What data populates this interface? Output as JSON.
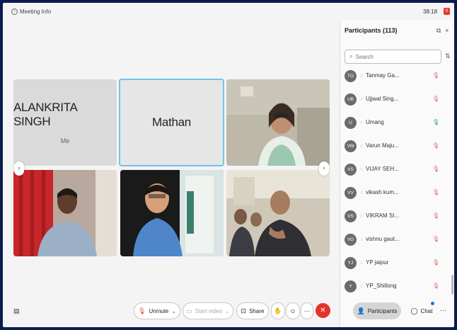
{
  "header": {
    "title": "Meeting Info",
    "time": "38:18",
    "rec_badge": "0"
  },
  "tiles": {
    "alankrita": {
      "name": "ALANKRITA SINGH",
      "sub": "Me"
    },
    "mathan": {
      "name": "Mathan"
    }
  },
  "panel": {
    "title": "Participants (113)",
    "search_placeholder": "Search",
    "participants": [
      {
        "initials": "TG",
        "name": "Tanmay Ga...",
        "mic": "muted"
      },
      {
        "initials": "UB",
        "name": "Ujjwal Sing...",
        "mic": "muted"
      },
      {
        "initials": "U",
        "name": "Umang",
        "mic": "on"
      },
      {
        "initials": "VM",
        "name": "Varun Maju...",
        "mic": "muted"
      },
      {
        "initials": "VS",
        "name": "VIJAY SEH...",
        "mic": "muted"
      },
      {
        "initials": "VV",
        "name": "vikash kum...",
        "mic": "muted"
      },
      {
        "initials": "VS",
        "name": "VIKRAM SI...",
        "mic": "muted"
      },
      {
        "initials": "VG",
        "name": "vishnu gaut...",
        "mic": "muted"
      },
      {
        "initials": "YJ",
        "name": "YP jaipur",
        "mic": "muted"
      },
      {
        "initials": "Y",
        "name": "YP_Shillong",
        "mic": "muted"
      }
    ]
  },
  "toolbar": {
    "unmute": "Unmute",
    "start_video": "Start video",
    "share": "Share",
    "participants": "Participants",
    "chat": "Chat"
  },
  "colors": {
    "muted": "#e0453a",
    "on": "#27a35a",
    "end": "#e2332a",
    "frame": "#0b1b4e"
  }
}
